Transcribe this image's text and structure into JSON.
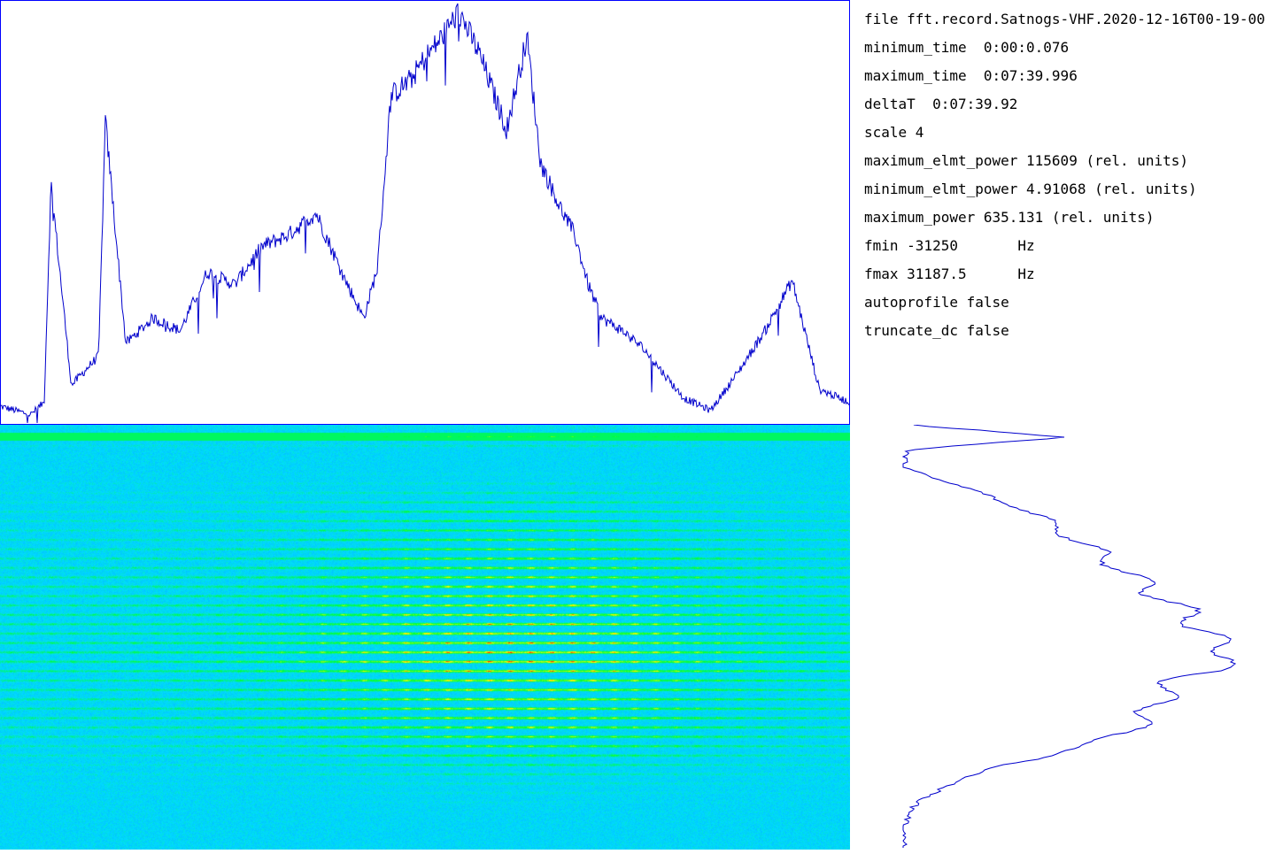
{
  "info": {
    "file": "file fft.record.Satnogs-VHF.2020-12-16T00-19-00",
    "minimum_time": "minimum_time  0:00:0.076",
    "maximum_time": "maximum_time  0:07:39.996",
    "deltaT": "deltaT  0:07:39.92",
    "scale": "scale 4",
    "maximum_elmt_power": "maximum_elmt_power 115609 (rel. units)",
    "minimum_elmt_power": "minimum_elmt_power 4.91068 (rel. units)",
    "maximum_power": "maximum_power 635.131 (rel. units)",
    "fmin": "fmin -31250       Hz",
    "fmax": "fmax 31187.5      Hz",
    "autoprofile": "autoprofile false",
    "truncate_dc": "truncate_dc false"
  },
  "colors": {
    "trace": "#0000cc",
    "border": "#0000ff",
    "background": "#ffffff"
  },
  "chart_data": [
    {
      "type": "line",
      "description_key": "frequency-profile",
      "x": [
        -31250,
        -29000,
        -28000,
        -27500,
        -26000,
        -24000,
        -23500,
        -22000,
        -20000,
        -18000,
        -16000,
        -14000,
        -12000,
        -10000,
        -8000,
        -6000,
        -4500,
        -3500,
        -2500,
        -1000,
        0,
        1000,
        2500,
        4000,
        6000,
        7500,
        8500,
        10000,
        11000,
        12000,
        13000,
        14500,
        16000,
        17500,
        19000,
        21000,
        23000,
        25000,
        27000,
        29000,
        31187
      ],
      "y": [
        0.04,
        0.02,
        0.05,
        0.57,
        0.09,
        0.16,
        0.72,
        0.19,
        0.25,
        0.22,
        0.36,
        0.33,
        0.42,
        0.45,
        0.5,
        0.35,
        0.25,
        0.37,
        0.78,
        0.82,
        0.87,
        0.91,
        0.98,
        0.88,
        0.7,
        0.92,
        0.62,
        0.51,
        0.45,
        0.33,
        0.25,
        0.22,
        0.18,
        0.12,
        0.06,
        0.03,
        0.12,
        0.22,
        0.34,
        0.08,
        0.05
      ],
      "ylim": [
        0,
        1
      ]
    },
    {
      "type": "heatmap",
      "description_key": "waterfall-spectrogram",
      "xlim": [
        -31250,
        31187.5
      ],
      "time_range": [
        "0:00:0.076",
        "0:07:39.996"
      ]
    },
    {
      "type": "line",
      "description_key": "time-profile",
      "t": [
        0,
        0.03,
        0.06,
        0.1,
        0.2,
        0.3,
        0.4,
        0.45,
        0.5,
        0.55,
        0.6,
        0.65,
        0.7,
        0.75,
        0.8,
        0.85,
        0.9,
        0.95,
        1.0
      ],
      "power": [
        0.02,
        0.45,
        0.01,
        0.0,
        0.35,
        0.55,
        0.72,
        0.81,
        0.86,
        0.95,
        0.78,
        0.72,
        0.68,
        0.55,
        0.3,
        0.12,
        0.03,
        0.0,
        0.0
      ]
    }
  ]
}
